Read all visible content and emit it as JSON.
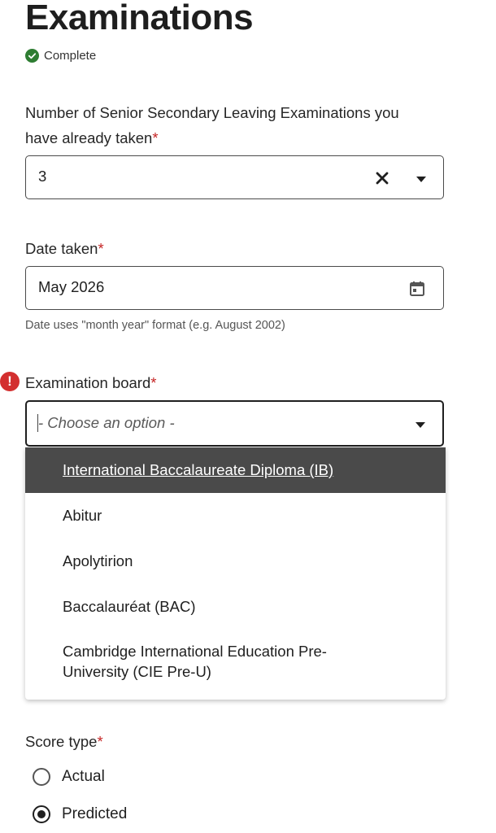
{
  "page": {
    "title": "Examinations",
    "status": "Complete"
  },
  "exams_taken": {
    "label_line1": "Number of Senior Secondary Leaving Examinations you",
    "label_line2": "have already taken",
    "required_mark": "*",
    "value": "3"
  },
  "date_taken": {
    "label": "Date taken",
    "required_mark": "*",
    "value": "May 2026",
    "hint": "Date uses \"month year\" format (e.g. August 2002)"
  },
  "exam_board": {
    "label": "Examination board",
    "required_mark": "*",
    "placeholder": "- Choose an option -",
    "error_glyph": "!",
    "options": [
      "International Baccalaureate Diploma (IB)",
      "Abitur",
      "Apolytirion",
      "Baccalauréat (BAC)",
      "Cambridge International Education Pre-",
      "University (CIE Pre-U)"
    ]
  },
  "score_type": {
    "label": "Score type",
    "required_mark": "*",
    "options": [
      "Actual",
      "Predicted"
    ],
    "selected": "Predicted"
  },
  "colors": {
    "complete_green": "#2e7d32",
    "required_red": "#c62828",
    "error_red": "#d32f2f",
    "highlight_bg": "#4a4a4a"
  }
}
